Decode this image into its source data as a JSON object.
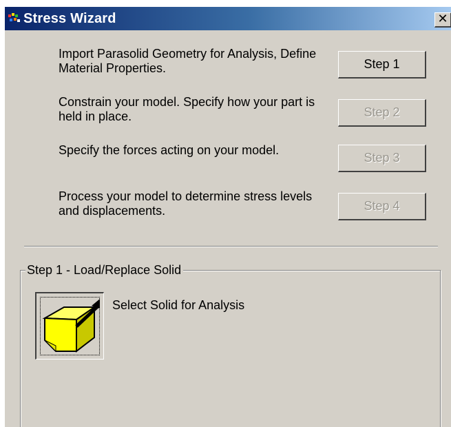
{
  "window": {
    "title": "Stress Wizard",
    "close_label": "✕"
  },
  "steps": [
    {
      "description": "Import Parasolid Geometry for Analysis, Define Material Properties.",
      "button_label": "Step 1",
      "enabled": true
    },
    {
      "description": "Constrain your model. Specify how your part is held in place.",
      "button_label": "Step 2",
      "enabled": false
    },
    {
      "description": "Specify the forces acting on your model.",
      "button_label": "Step 3",
      "enabled": false
    },
    {
      "description": "Process your model to determine stress levels and displacements.",
      "button_label": "Step 4",
      "enabled": false
    }
  ],
  "group": {
    "title": "Step 1 - Load/Replace Solid",
    "select_solid_label": "Select Solid for Analysis",
    "select_solid_icon": "solid-block-select-icon"
  },
  "colors": {
    "face": "#d4d0c8",
    "title_gradient_start": "#0a246a",
    "title_gradient_end": "#a6caf0",
    "solid_yellow": "#ffff00"
  }
}
